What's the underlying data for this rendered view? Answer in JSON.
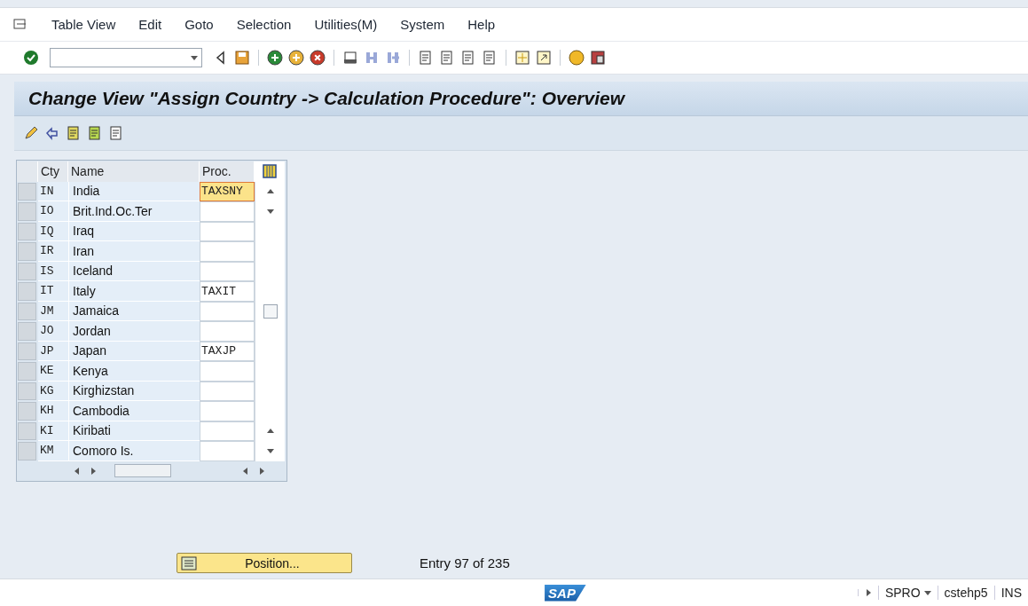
{
  "menu": [
    "Table View",
    "Edit",
    "Goto",
    "Selection",
    "Utilities(M)",
    "System",
    "Help"
  ],
  "title": "Change View \"Assign Country -> Calculation Procedure\": Overview",
  "table": {
    "columns": [
      "Cty",
      "Name",
      "Proc."
    ],
    "rows": [
      {
        "cty": "IN",
        "name": "India",
        "proc": "TAXSNY",
        "focused": true
      },
      {
        "cty": "IO",
        "name": "Brit.Ind.Oc.Ter",
        "proc": "",
        "focused": false
      },
      {
        "cty": "IQ",
        "name": "Iraq",
        "proc": "",
        "focused": false
      },
      {
        "cty": "IR",
        "name": "Iran",
        "proc": "",
        "focused": false
      },
      {
        "cty": "IS",
        "name": "Iceland",
        "proc": "",
        "focused": false
      },
      {
        "cty": "IT",
        "name": "Italy",
        "proc": "TAXIT",
        "focused": false
      },
      {
        "cty": "JM",
        "name": "Jamaica",
        "proc": "",
        "focused": false
      },
      {
        "cty": "JO",
        "name": "Jordan",
        "proc": "",
        "focused": false
      },
      {
        "cty": "JP",
        "name": "Japan",
        "proc": "TAXJP",
        "focused": false
      },
      {
        "cty": "KE",
        "name": "Kenya",
        "proc": "",
        "focused": false
      },
      {
        "cty": "KG",
        "name": "Kirghizstan",
        "proc": "",
        "focused": false
      },
      {
        "cty": "KH",
        "name": "Cambodia",
        "proc": "",
        "focused": false
      },
      {
        "cty": "KI",
        "name": "Kiribati",
        "proc": "",
        "focused": false
      },
      {
        "cty": "KM",
        "name": "Comoro Is.",
        "proc": "",
        "focused": false
      }
    ]
  },
  "position_button": "Position...",
  "entry_info": "Entry 97 of 235",
  "status_bar": {
    "logo": "SAP",
    "transaction": "SPRO",
    "server": "cstehp5",
    "mode": "INS"
  }
}
